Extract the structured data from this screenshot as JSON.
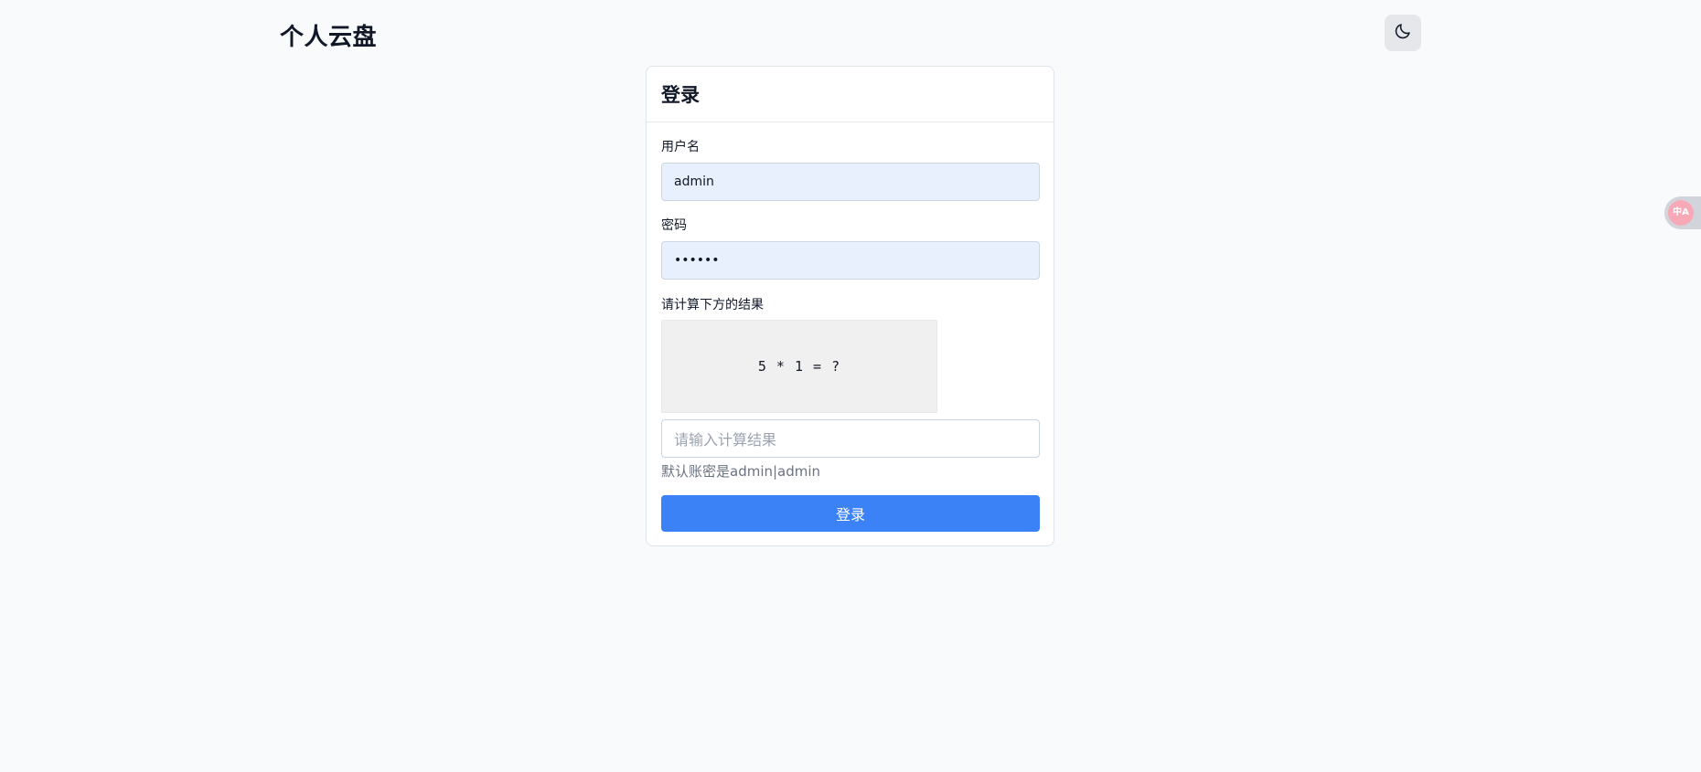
{
  "header": {
    "brand": "个人云盘",
    "theme_icon": "moon-icon"
  },
  "login_card": {
    "title": "登录",
    "username": {
      "label": "用户名",
      "value": "admin"
    },
    "password": {
      "label": "密码",
      "masked_value": "••••••"
    },
    "captcha": {
      "label": "请计算下方的结果",
      "expression": "5 * 1 = ?",
      "placeholder": "请输入计算结果"
    },
    "hint": "默认账密是admin|admin",
    "submit_label": "登录"
  },
  "translate_widget": {
    "icon": "translate-icon",
    "glyph": "中A"
  },
  "colors": {
    "background": "#f8fafc",
    "primary_button": "#3b82f6",
    "filled_input": "#e8f0fe",
    "captcha_background": "#f0f0f0"
  }
}
